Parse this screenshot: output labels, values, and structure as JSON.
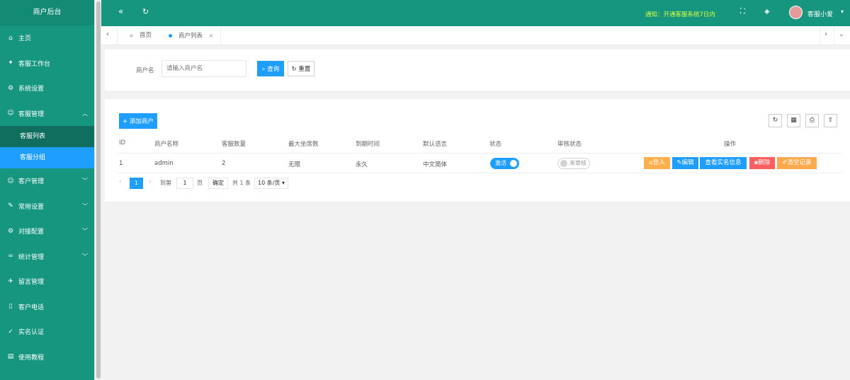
{
  "colors": {
    "sidebar": "#17967f",
    "primary": "#1e9fff",
    "notice": "#d5ff3e",
    "login": "#ffb04d",
    "delete": "#ff5e5e",
    "clear": "#ffa94d"
  },
  "sidebar": {
    "title": "商户后台",
    "items": [
      {
        "icon": "home-icon",
        "glyph": "⌂",
        "label": "主页"
      },
      {
        "icon": "workbench-icon",
        "glyph": "✦",
        "label": "客服工作台"
      },
      {
        "icon": "gear-icon",
        "glyph": "⚙",
        "label": "系统设置"
      },
      {
        "icon": "user-icon",
        "glyph": "☺",
        "label": "客服管理"
      }
    ],
    "sub_items": [
      {
        "label": "客服列表"
      },
      {
        "label": "客服分组"
      }
    ],
    "items2": [
      {
        "icon": "customer-icon",
        "glyph": "☺",
        "label": "客户管理"
      },
      {
        "icon": "phrase-icon",
        "glyph": "✎",
        "label": "常用设置"
      },
      {
        "icon": "plug-icon",
        "glyph": "⚙",
        "label": "对接配置"
      },
      {
        "icon": "stats-icon",
        "glyph": "∞",
        "label": "统计管理"
      },
      {
        "icon": "message-icon",
        "glyph": "✈",
        "label": "留言管理"
      },
      {
        "icon": "phone-icon",
        "glyph": "▯",
        "label": "客户电话"
      },
      {
        "icon": "verify-icon",
        "glyph": "✓",
        "label": "实名认证"
      },
      {
        "icon": "book-icon",
        "glyph": "▤",
        "label": "使用教程"
      }
    ]
  },
  "header": {
    "collapse_glyph": "«",
    "refresh_glyph": "↻",
    "notice": "通知：开通客服系统7日内",
    "username": "客服小爱"
  },
  "tabs": [
    {
      "label": "首页"
    },
    {
      "label": "商户列表",
      "close": "×"
    }
  ],
  "search": {
    "label": "商户名",
    "placeholder": "请输入商户名",
    "search_label": "查询",
    "reset_label": "重置"
  },
  "toolbar": {
    "add_label": "添加商户"
  },
  "table": {
    "columns": [
      "ID",
      "商户名称",
      "客服数量",
      "最大坐席数",
      "到期时间",
      "默认语言",
      "状态",
      "审核状态",
      "操作"
    ],
    "rows": [
      {
        "id": "1",
        "name": "admin",
        "agents": "2",
        "max_seats": "无限",
        "expire": "永久",
        "language": "中文简体",
        "status": "激活",
        "audit": "未审核"
      }
    ],
    "actions": [
      "登入",
      "编辑",
      "查看实名信息",
      "删除",
      "清空记录"
    ]
  },
  "pagination": {
    "current": "1",
    "goto_label": "到第",
    "page_input": "1",
    "page_unit": "页",
    "confirm": "确定",
    "total": "共 1 条",
    "per_page": "10 条/页"
  }
}
